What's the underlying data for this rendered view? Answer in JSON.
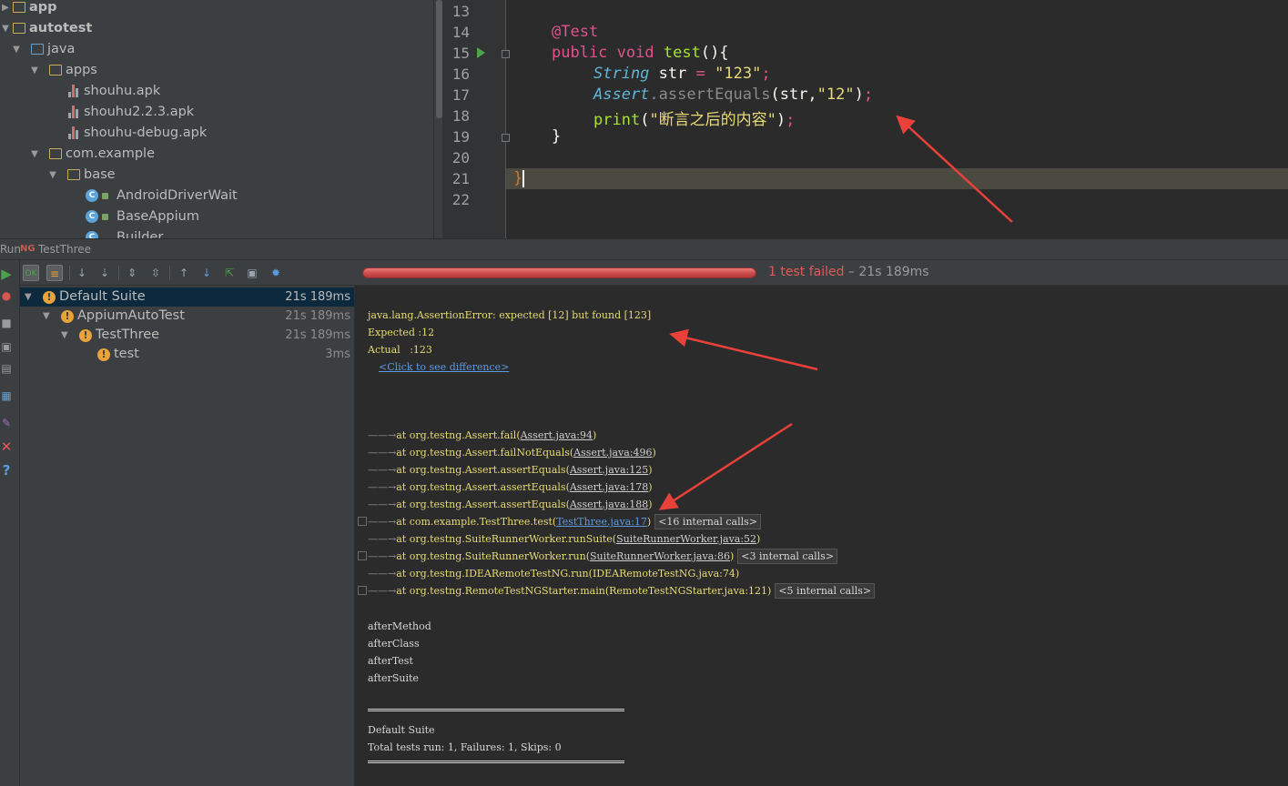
{
  "project_tree": {
    "items": [
      {
        "label": "app",
        "bold": true
      },
      {
        "label": "autotest",
        "bold": true
      },
      {
        "label": "java"
      },
      {
        "label": "apps"
      },
      {
        "label": "shouhu.apk"
      },
      {
        "label": "shouhu2.2.3.apk"
      },
      {
        "label": "shouhu-debug.apk"
      },
      {
        "label": "com.example"
      },
      {
        "label": "base"
      },
      {
        "label": "AndroidDriverWait"
      },
      {
        "label": "BaseAppium"
      },
      {
        "label": "Builder"
      }
    ]
  },
  "editor": {
    "line_numbers": [
      "13",
      "14",
      "15",
      "16",
      "17",
      "18",
      "19",
      "20",
      "21",
      "22"
    ],
    "current_line": "21",
    "code": {
      "annotation": "@Test",
      "kw_public": "public",
      "kw_void": "void",
      "method_name": "test",
      "method_parens": "(){",
      "type_string": "String",
      "var_str": "str",
      "assign": "=",
      "str_123": "\"123\"",
      "semicolon": ";",
      "type_assert": "Assert",
      "assert_method": ".assertEquals",
      "assert_args_open": "(str,",
      "str_12": "\"12\"",
      "close_paren": ")",
      "print_fn": "print",
      "print_open": "(",
      "print_str": "\"断言之后的内容\"",
      "print_close": ")",
      "close_brace_method": "}",
      "close_brace_class": "}"
    }
  },
  "run_panel": {
    "run_label": "Run",
    "config_icon_text": "NG",
    "config_name": "TestThree"
  },
  "test_tree": {
    "rows": [
      {
        "name": "Default Suite",
        "time": "21s 189ms"
      },
      {
        "name": "AppiumAutoTest",
        "time": "21s 189ms"
      },
      {
        "name": "TestThree",
        "time": "21s 189ms"
      },
      {
        "name": "test",
        "time": "3ms"
      }
    ]
  },
  "progress": {
    "fraction": 1.0,
    "failed_text": "1 test failed",
    "duration_text": " – 21s 189ms"
  },
  "console": {
    "error_line": "java.lang.AssertionError: expected [12] but found [123]",
    "expected_label": "Expected",
    "expected_value": ":12",
    "actual_label": "Actual",
    "actual_value": ":123",
    "diff_link": "<Click to see difference>",
    "stack_arrow": "——→",
    "stack": [
      {
        "text": "at org.testng.Assert.fail(",
        "loc": "Assert.java:94",
        "end": ")",
        "internal": ""
      },
      {
        "text": "at org.testng.Assert.failNotEquals(",
        "loc": "Assert.java:496",
        "end": ")",
        "internal": ""
      },
      {
        "text": "at org.testng.Assert.assertEquals(",
        "loc": "Assert.java:125",
        "end": ")",
        "internal": ""
      },
      {
        "text": "at org.testng.Assert.assertEquals(",
        "loc": "Assert.java:178",
        "end": ")",
        "internal": ""
      },
      {
        "text": "at org.testng.Assert.assertEquals(",
        "loc": "Assert.java:188",
        "end": ")",
        "internal": ""
      },
      {
        "text": "at com.example.TestThree.test(",
        "loc": "TestThree.java:17",
        "end": ")",
        "internal": "<16 internal calls>"
      },
      {
        "text": "at org.testng.SuiteRunnerWorker.runSuite(",
        "loc": "SuiteRunnerWorker.java:52",
        "end": ")",
        "internal": ""
      },
      {
        "text": "at org.testng.SuiteRunnerWorker.run(",
        "loc": "SuiteRunnerWorker.java:86",
        "end": ")",
        "internal": "<3 internal calls>"
      },
      {
        "text": "at org.testng.IDEARemoteTestNG.run(",
        "loc": "IDEARemoteTestNG.java:74",
        "end": ")",
        "internal": ""
      },
      {
        "text": "at org.testng.RemoteTestNGStarter.main(",
        "loc": "RemoteTestNGStarter.java:121",
        "end": ")",
        "internal": "<5 internal calls>"
      }
    ],
    "after_lines": [
      "afterMethod",
      "afterClass",
      "afterTest",
      "afterSuite"
    ],
    "summary_title": "Default Suite",
    "summary_line": "Total tests run: 1, Failures: 1, Skips: 0"
  },
  "colors": {
    "annotation_arrows": "#e8413a",
    "fail_text": "#e05a5a",
    "progress_fill": "#c94848"
  },
  "icons": [
    "folder-icon",
    "apk-file-icon",
    "java-class-icon",
    "run-icon",
    "warning-icon",
    "close-icon",
    "help-icon"
  ]
}
